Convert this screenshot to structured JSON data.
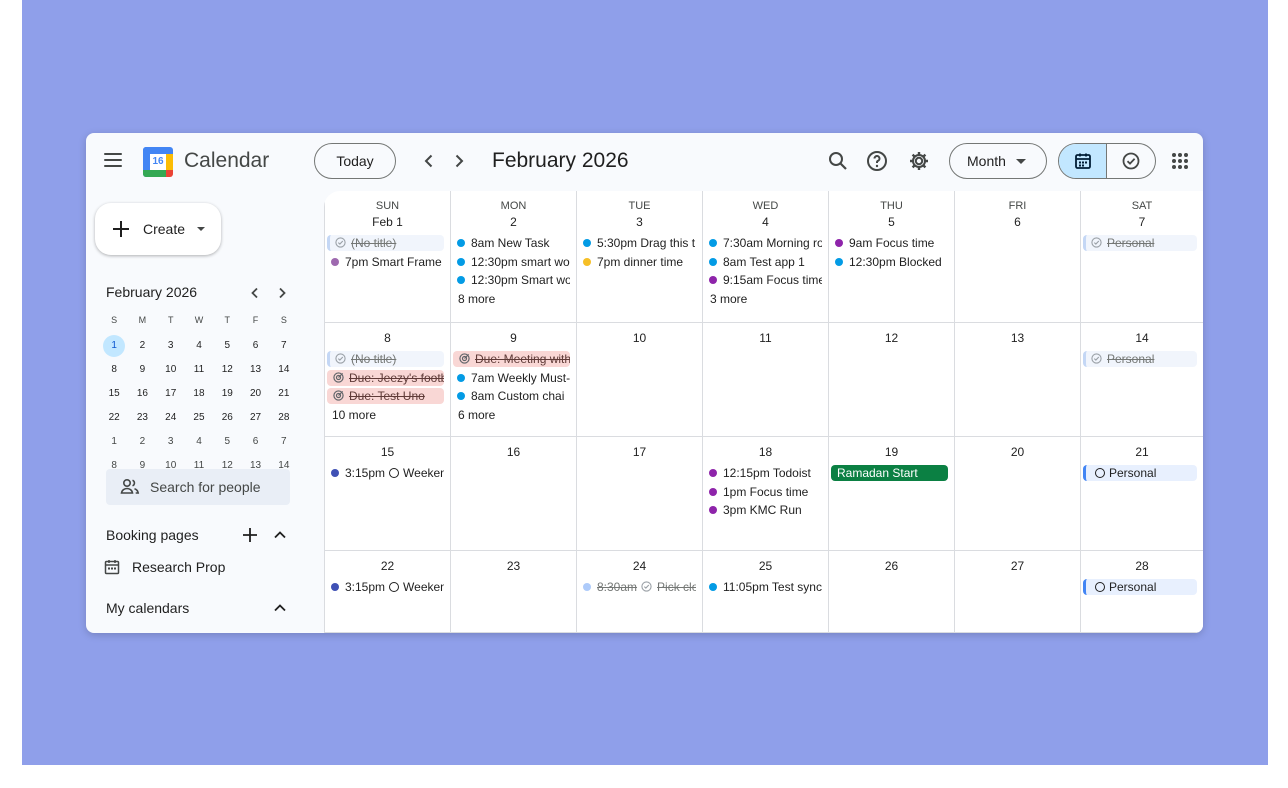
{
  "app": {
    "title": "Calendar",
    "logo_day": "16"
  },
  "header": {
    "today_label": "Today",
    "current_period": "February 2026",
    "view_label": "Month"
  },
  "sidebar": {
    "create_label": "Create",
    "mini_calendar": {
      "title": "February 2026",
      "weekdays": [
        "S",
        "M",
        "T",
        "W",
        "T",
        "F",
        "S"
      ],
      "weeks": [
        [
          "1",
          "2",
          "3",
          "4",
          "5",
          "6",
          "7"
        ],
        [
          "8",
          "9",
          "10",
          "11",
          "12",
          "13",
          "14"
        ],
        [
          "15",
          "16",
          "17",
          "18",
          "19",
          "20",
          "21"
        ],
        [
          "22",
          "23",
          "24",
          "25",
          "26",
          "27",
          "28"
        ],
        [
          "1",
          "2",
          "3",
          "4",
          "5",
          "6",
          "7"
        ],
        [
          "8",
          "9",
          "10",
          "11",
          "12",
          "13",
          "14"
        ]
      ],
      "selected": "1"
    },
    "search_people_label": "Search for people",
    "booking_pages_title": "Booking pages",
    "booking_items": [
      "Research Prop"
    ],
    "my_calendars_title": "My calendars"
  },
  "colors": {
    "accent": "#0b57d0",
    "selected_bg": "#c2e7ff",
    "blue_dot": "#039be5",
    "purple_dot": "#8e24aa",
    "violet_dot": "#9e69af",
    "yellow_dot": "#f6bf26",
    "indigo_dot": "#3f51b5",
    "ramadan_green": "#0b8043",
    "pink_task": "#f9d7d5",
    "background": "#8f9fea"
  },
  "month_grid": {
    "weekday_labels": [
      "SUN",
      "MON",
      "TUE",
      "WED",
      "THU",
      "FRI",
      "SAT"
    ],
    "weeks": [
      {
        "days": [
          {
            "num": "Feb 1",
            "events": [
              {
                "kind": "task-light",
                "text": "(No title)"
              },
              {
                "kind": "dot",
                "color": "#9e69af",
                "text": "7pm Smart Frame"
              }
            ]
          },
          {
            "num": "2",
            "events": [
              {
                "kind": "dot",
                "color": "#039be5",
                "text": "8am New Task"
              },
              {
                "kind": "dot",
                "color": "#039be5",
                "text": "12:30pm smart wo"
              },
              {
                "kind": "dot",
                "color": "#039be5",
                "text": "12:30pm Smart wo"
              }
            ],
            "more": "8 more"
          },
          {
            "num": "3",
            "events": [
              {
                "kind": "dot",
                "color": "#039be5",
                "text": "5:30pm Drag this t"
              },
              {
                "kind": "dot",
                "color": "#f6bf26",
                "text": "7pm dinner time"
              }
            ]
          },
          {
            "num": "4",
            "events": [
              {
                "kind": "dot",
                "color": "#039be5",
                "text": "7:30am Morning ro"
              },
              {
                "kind": "dot",
                "color": "#039be5",
                "text": "8am Test app 1"
              },
              {
                "kind": "dot",
                "color": "#8e24aa",
                "text": "9:15am Focus time"
              }
            ],
            "more": "3 more"
          },
          {
            "num": "5",
            "events": [
              {
                "kind": "dot",
                "color": "#8e24aa",
                "text": "9am Focus time"
              },
              {
                "kind": "dot",
                "color": "#039be5",
                "text": "12:30pm Blocked"
              }
            ]
          },
          {
            "num": "6",
            "events": []
          },
          {
            "num": "7",
            "events": [
              {
                "kind": "task-light",
                "text": "Personal"
              }
            ]
          }
        ]
      },
      {
        "days": [
          {
            "num": "8",
            "events": [
              {
                "kind": "task-light",
                "text": "(No title)"
              },
              {
                "kind": "task-pink",
                "text": "Due: Jeezy's footb"
              },
              {
                "kind": "task-pink",
                "text": "Due: Test Uno"
              }
            ],
            "more": "10 more"
          },
          {
            "num": "9",
            "events": [
              {
                "kind": "task-pink",
                "text": "Due: Meeting with"
              },
              {
                "kind": "dot",
                "color": "#039be5",
                "text": "7am Weekly Must-"
              },
              {
                "kind": "dot",
                "color": "#039be5",
                "text": "8am Custom chai"
              }
            ],
            "more": "6 more"
          },
          {
            "num": "10",
            "events": []
          },
          {
            "num": "11",
            "events": []
          },
          {
            "num": "12",
            "events": []
          },
          {
            "num": "13",
            "events": []
          },
          {
            "num": "14",
            "events": [
              {
                "kind": "task-light",
                "text": "Personal"
              }
            ]
          }
        ]
      },
      {
        "days": [
          {
            "num": "15",
            "events": [
              {
                "kind": "ring",
                "color": "#3f51b5",
                "time": "3:15pm",
                "text": "Weeken"
              }
            ]
          },
          {
            "num": "16",
            "events": []
          },
          {
            "num": "17",
            "events": []
          },
          {
            "num": "18",
            "events": [
              {
                "kind": "dot",
                "color": "#8e24aa",
                "text": "12:15pm Todoist"
              },
              {
                "kind": "dot",
                "color": "#8e24aa",
                "text": "1pm Focus time"
              },
              {
                "kind": "dot",
                "color": "#8e24aa",
                "text": "3pm KMC Run"
              }
            ]
          },
          {
            "num": "19",
            "events": [
              {
                "kind": "chip-green",
                "text": "Ramadan Start"
              }
            ]
          },
          {
            "num": "20",
            "events": []
          },
          {
            "num": "21",
            "events": [
              {
                "kind": "chip-blue",
                "text": "Personal"
              }
            ]
          }
        ]
      },
      {
        "days": [
          {
            "num": "22",
            "events": [
              {
                "kind": "ring",
                "color": "#3f51b5",
                "time": "3:15pm",
                "text": "Weeken"
              }
            ]
          },
          {
            "num": "23",
            "events": []
          },
          {
            "num": "24",
            "events": [
              {
                "kind": "struck-dot",
                "color": "#aecbfa",
                "time": "8:30am",
                "text": "Pick clo"
              }
            ]
          },
          {
            "num": "25",
            "events": [
              {
                "kind": "dot",
                "color": "#039be5",
                "text": "11:05pm Test sync"
              }
            ]
          },
          {
            "num": "26",
            "events": []
          },
          {
            "num": "27",
            "events": []
          },
          {
            "num": "28",
            "events": [
              {
                "kind": "chip-blue",
                "text": "Personal"
              }
            ]
          }
        ]
      }
    ]
  }
}
